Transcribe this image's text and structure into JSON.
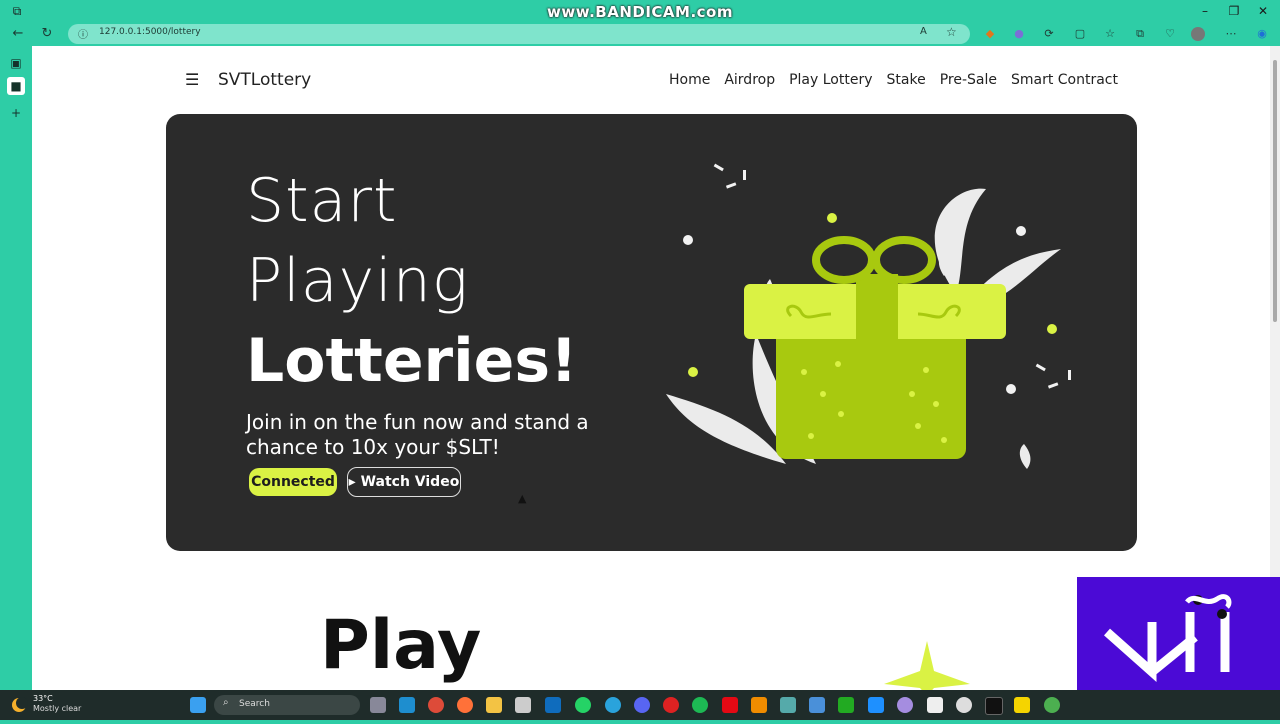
{
  "watermark": "www.BANDICAM.com",
  "browser": {
    "url": "127.0.0.1:5000/lottery"
  },
  "site": {
    "menu_icon": "hamburger-icon",
    "logo": "SVTLottery",
    "nav": [
      "Home",
      "Airdrop",
      "Play Lottery",
      "Stake",
      "Pre-Sale",
      "Smart Contract"
    ]
  },
  "hero": {
    "line1": "Start",
    "line2": "Playing",
    "line3": "Lotteries!",
    "subtitle": "Join in on the fun now and stand a chance to 10x your $SLT!",
    "connected_label": "Connected",
    "watch_label": "▸ Watch Video",
    "illustration": "gift-box-illustration"
  },
  "section": {
    "title": "Play"
  },
  "taskbar": {
    "temperature": "33°C",
    "weather": "Mostly clear",
    "search_label": "Search"
  },
  "colors": {
    "accent": "#daf244",
    "hero_bg": "#2b2b2b",
    "chrome": "#2ecda6",
    "brand_overlay": "#4b0ad6"
  }
}
